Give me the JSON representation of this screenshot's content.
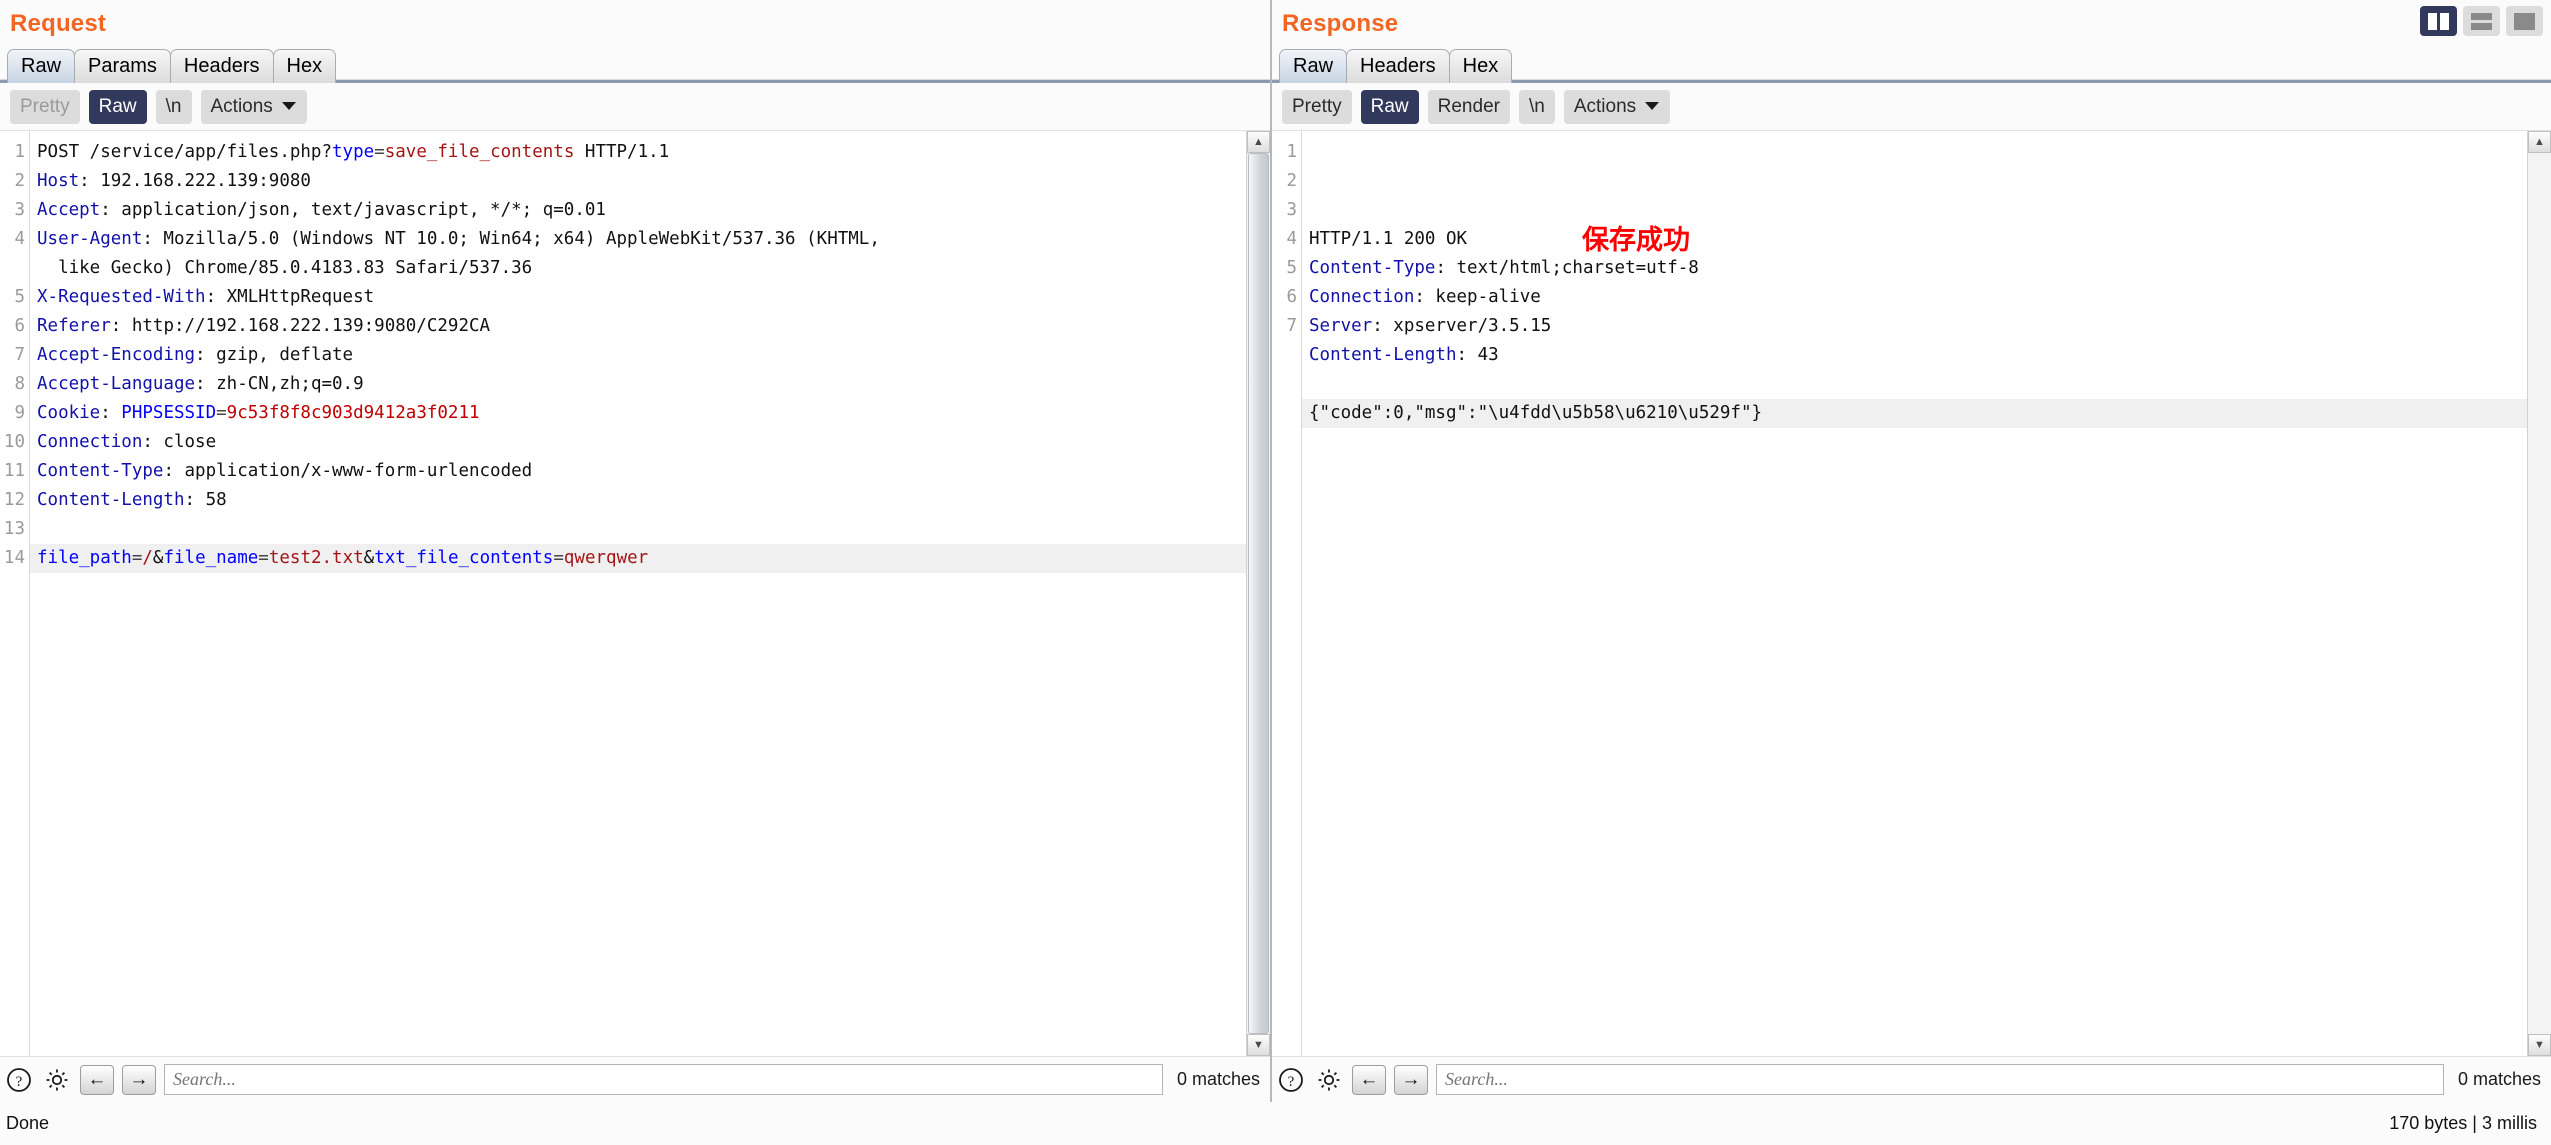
{
  "layout_toggles": [
    {
      "name": "split-vertical",
      "active": true
    },
    {
      "name": "split-horizontal",
      "active": false
    },
    {
      "name": "single-pane",
      "active": false
    }
  ],
  "request": {
    "title": "Request",
    "tabs": [
      {
        "label": "Raw",
        "active": true
      },
      {
        "label": "Params",
        "active": false
      },
      {
        "label": "Headers",
        "active": false
      },
      {
        "label": "Hex",
        "active": false
      }
    ],
    "format_buttons": [
      {
        "label": "Pretty",
        "state": "muted"
      },
      {
        "label": "Raw",
        "state": "active"
      },
      {
        "label": "\\n",
        "state": "normal"
      }
    ],
    "actions_label": "Actions",
    "lines": [
      {
        "n": "1",
        "parts": [
          {
            "t": "POST /service/app/files.php?",
            "c": "k-txt"
          },
          {
            "t": "type",
            "c": "k-par"
          },
          {
            "t": "=",
            "c": "k-sep"
          },
          {
            "t": "save_file_contents",
            "c": "k-val"
          },
          {
            "t": " HTTP/1.1",
            "c": "k-txt"
          }
        ]
      },
      {
        "n": "2",
        "parts": [
          {
            "t": "Host",
            "c": "k-hdr"
          },
          {
            "t": ": 192.168.222.139:9080",
            "c": "k-txt"
          }
        ]
      },
      {
        "n": "3",
        "parts": [
          {
            "t": "Accept",
            "c": "k-hdr"
          },
          {
            "t": ": application/json, text/javascript, */*; q=0.01",
            "c": "k-txt"
          }
        ]
      },
      {
        "n": "4",
        "parts": [
          {
            "t": "User-Agent",
            "c": "k-hdr"
          },
          {
            "t": ": Mozilla/5.0 (Windows NT 10.0; Win64; x64) AppleWebKit/537.36 (KHTML,",
            "c": "k-txt"
          }
        ]
      },
      {
        "n": "",
        "parts": [
          {
            "t": "  like Gecko) Chrome/85.0.4183.83 Safari/537.36",
            "c": "k-txt"
          }
        ]
      },
      {
        "n": "5",
        "parts": [
          {
            "t": "X-Requested-With",
            "c": "k-hdr"
          },
          {
            "t": ": XMLHttpRequest",
            "c": "k-txt"
          }
        ]
      },
      {
        "n": "6",
        "parts": [
          {
            "t": "Referer",
            "c": "k-hdr"
          },
          {
            "t": ": http://192.168.222.139:9080/C292CA",
            "c": "k-txt"
          }
        ]
      },
      {
        "n": "7",
        "parts": [
          {
            "t": "Accept-Encoding",
            "c": "k-hdr"
          },
          {
            "t": ": gzip, deflate",
            "c": "k-txt"
          }
        ]
      },
      {
        "n": "8",
        "parts": [
          {
            "t": "Accept-Language",
            "c": "k-hdr"
          },
          {
            "t": ": zh-CN,zh;q=0.9",
            "c": "k-txt"
          }
        ]
      },
      {
        "n": "9",
        "parts": [
          {
            "t": "Cookie",
            "c": "k-hdr"
          },
          {
            "t": ": ",
            "c": "k-txt"
          },
          {
            "t": "PHPSESSID",
            "c": "k-par"
          },
          {
            "t": "=",
            "c": "k-sep"
          },
          {
            "t": "9c53f8f8c903d9412a3f0211",
            "c": "k-valr"
          }
        ]
      },
      {
        "n": "10",
        "parts": [
          {
            "t": "Connection",
            "c": "k-hdr"
          },
          {
            "t": ": close",
            "c": "k-txt"
          }
        ]
      },
      {
        "n": "11",
        "parts": [
          {
            "t": "Content-Type",
            "c": "k-hdr"
          },
          {
            "t": ": application/x-www-form-urlencoded",
            "c": "k-txt"
          }
        ]
      },
      {
        "n": "12",
        "parts": [
          {
            "t": "Content-Length",
            "c": "k-hdr"
          },
          {
            "t": ": 58",
            "c": "k-txt"
          }
        ]
      },
      {
        "n": "13",
        "parts": []
      },
      {
        "n": "14",
        "highlight": true,
        "parts": [
          {
            "t": "file_path",
            "c": "k-par"
          },
          {
            "t": "=",
            "c": "k-sep"
          },
          {
            "t": "/",
            "c": "k-val"
          },
          {
            "t": "&",
            "c": "k-txt"
          },
          {
            "t": "file_name",
            "c": "k-par"
          },
          {
            "t": "=",
            "c": "k-sep"
          },
          {
            "t": "test2.txt",
            "c": "k-val"
          },
          {
            "t": "&",
            "c": "k-txt"
          },
          {
            "t": "txt_file_contents",
            "c": "k-par"
          },
          {
            "t": "=",
            "c": "k-sep"
          },
          {
            "t": "qwerqwer",
            "c": "k-val"
          }
        ]
      }
    ],
    "search_placeholder": "Search...",
    "matches": "0 matches"
  },
  "response": {
    "title": "Response",
    "tabs": [
      {
        "label": "Raw",
        "active": true
      },
      {
        "label": "Headers",
        "active": false
      },
      {
        "label": "Hex",
        "active": false
      }
    ],
    "format_buttons": [
      {
        "label": "Pretty",
        "state": "normal"
      },
      {
        "label": "Raw",
        "state": "active"
      },
      {
        "label": "Render",
        "state": "normal"
      },
      {
        "label": "\\n",
        "state": "normal"
      }
    ],
    "actions_label": "Actions",
    "lines": [
      {
        "n": "1",
        "parts": [
          {
            "t": "HTTP/1.1 200 OK",
            "c": "k-txt"
          }
        ]
      },
      {
        "n": "2",
        "parts": [
          {
            "t": "Content-Type",
            "c": "k-hdr"
          },
          {
            "t": ": text/html;charset=utf-8",
            "c": "k-txt"
          }
        ]
      },
      {
        "n": "3",
        "parts": [
          {
            "t": "Connection",
            "c": "k-hdr"
          },
          {
            "t": ": keep-alive",
            "c": "k-txt"
          }
        ]
      },
      {
        "n": "4",
        "parts": [
          {
            "t": "Server",
            "c": "k-hdr"
          },
          {
            "t": ": xpserver/3.5.15",
            "c": "k-txt"
          }
        ]
      },
      {
        "n": "5",
        "parts": [
          {
            "t": "Content-Length",
            "c": "k-hdr"
          },
          {
            "t": ": 43",
            "c": "k-txt"
          }
        ]
      },
      {
        "n": "6",
        "parts": []
      },
      {
        "n": "7",
        "highlight": true,
        "parts": [
          {
            "t": "{\"code\":0,\"msg\":\"\\u4fdd\\u5b58\\u6210\\u529f\"}",
            "c": "k-txt"
          }
        ]
      }
    ],
    "annotation": "保存成功",
    "search_placeholder": "Search...",
    "matches": "0 matches"
  },
  "status": {
    "left": "Done",
    "right": "170 bytes | 3 millis"
  }
}
